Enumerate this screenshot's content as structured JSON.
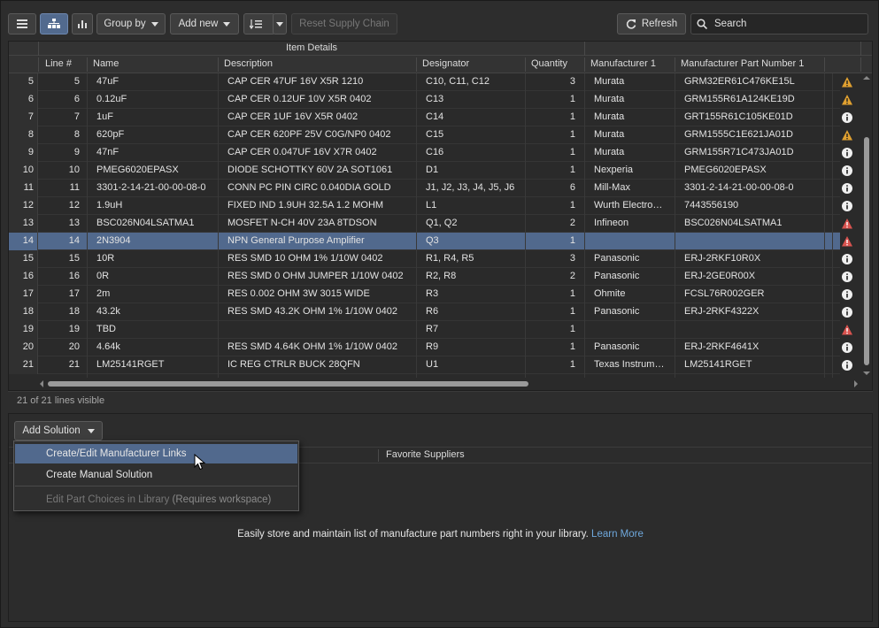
{
  "toolbar": {
    "group_by_label": "Group by",
    "add_new_label": "Add new",
    "reset_label": "Reset Supply Chain",
    "refresh_label": "Refresh",
    "search_placeholder": "Search"
  },
  "grid": {
    "group_header": "Item Details",
    "columns": [
      "Line #",
      "Name",
      "Description",
      "Designator",
      "Quantity",
      "Manufacturer 1",
      "Manufacturer Part Number 1"
    ],
    "rows": [
      {
        "idx": "5",
        "line": "5",
        "name": "47uF",
        "desc": "CAP CER 47UF 16V X5R 1210",
        "des": "C10, C11, C12",
        "qty": "3",
        "mfr": "Murata",
        "mpn": "GRM32ER61C476KE15L",
        "icon": "warning-icon"
      },
      {
        "idx": "6",
        "line": "6",
        "name": "0.12uF",
        "desc": "CAP CER 0.12UF 10V X5R 0402",
        "des": "C13",
        "qty": "1",
        "mfr": "Murata",
        "mpn": "GRM155R61A124KE19D",
        "icon": "warning-icon"
      },
      {
        "idx": "7",
        "line": "7",
        "name": "1uF",
        "desc": "CAP CER 1UF 16V X5R 0402",
        "des": "C14",
        "qty": "1",
        "mfr": "Murata",
        "mpn": "GRT155R61C105KE01D",
        "icon": "info-icon"
      },
      {
        "idx": "8",
        "line": "8",
        "name": "620pF",
        "desc": "CAP CER 620PF 25V C0G/NP0 0402",
        "des": "C15",
        "qty": "1",
        "mfr": "Murata",
        "mpn": "GRM1555C1E621JA01D",
        "icon": "warning-icon"
      },
      {
        "idx": "9",
        "line": "9",
        "name": "47nF",
        "desc": "CAP CER 0.047UF 16V X7R 0402",
        "des": "C16",
        "qty": "1",
        "mfr": "Murata",
        "mpn": "GRM155R71C473JA01D",
        "icon": "info-icon"
      },
      {
        "idx": "10",
        "line": "10",
        "name": "PMEG6020EPASX",
        "desc": "DIODE SCHOTTKY 60V 2A SOT1061",
        "des": "D1",
        "qty": "1",
        "mfr": "Nexperia",
        "mpn": "PMEG6020EPASX",
        "icon": "info-icon"
      },
      {
        "idx": "11",
        "line": "11",
        "name": "3301-2-14-21-00-00-08-0",
        "desc": "CONN PC PIN CIRC 0.040DIA GOLD",
        "des": "J1, J2, J3, J4, J5, J6",
        "qty": "6",
        "mfr": "Mill-Max",
        "mpn": "3301-2-14-21-00-00-08-0",
        "icon": "info-icon"
      },
      {
        "idx": "12",
        "line": "12",
        "name": "1.9uH",
        "desc": "FIXED IND 1.9UH 32.5A 1.2 MOHM",
        "des": "L1",
        "qty": "1",
        "mfr": "Wurth Electro…",
        "mpn": "7443556190",
        "icon": "info-icon"
      },
      {
        "idx": "13",
        "line": "13",
        "name": "BSC026N04LSATMA1",
        "desc": "MOSFET N-CH 40V 23A 8TDSON",
        "des": "Q1, Q2",
        "qty": "2",
        "mfr": "Infineon",
        "mpn": "BSC026N04LSATMA1",
        "icon": "error-icon"
      },
      {
        "idx": "14",
        "line": "14",
        "name": "2N3904",
        "desc": "NPN General Purpose Amplifier",
        "des": "Q3",
        "qty": "1",
        "mfr": "",
        "mpn": "",
        "icon": "error-icon",
        "selected": true
      },
      {
        "idx": "15",
        "line": "15",
        "name": "10R",
        "desc": "RES SMD 10 OHM 1% 1/10W 0402",
        "des": "R1, R4, R5",
        "qty": "3",
        "mfr": "Panasonic",
        "mpn": "ERJ-2RKF10R0X",
        "icon": "info-icon"
      },
      {
        "idx": "16",
        "line": "16",
        "name": "0R",
        "desc": "RES SMD 0 OHM JUMPER 1/10W 0402",
        "des": "R2, R8",
        "qty": "2",
        "mfr": "Panasonic",
        "mpn": "ERJ-2GE0R00X",
        "icon": "info-icon"
      },
      {
        "idx": "17",
        "line": "17",
        "name": "2m",
        "desc": "RES 0.002 OHM 3W 3015 WIDE",
        "des": "R3",
        "qty": "1",
        "mfr": "Ohmite",
        "mpn": "FCSL76R002GER",
        "icon": "info-icon"
      },
      {
        "idx": "18",
        "line": "18",
        "name": "43.2k",
        "desc": "RES SMD 43.2K OHM 1% 1/10W 0402",
        "des": "R6",
        "qty": "1",
        "mfr": "Panasonic",
        "mpn": "ERJ-2RKF4322X",
        "icon": "info-icon"
      },
      {
        "idx": "19",
        "line": "19",
        "name": "TBD",
        "desc": "",
        "des": "R7",
        "qty": "1",
        "mfr": "",
        "mpn": "",
        "icon": "error-icon"
      },
      {
        "idx": "20",
        "line": "20",
        "name": "4.64k",
        "desc": "RES SMD 4.64K OHM 1% 1/10W 0402",
        "des": "R9",
        "qty": "1",
        "mfr": "Panasonic",
        "mpn": "ERJ-2RKF4641X",
        "icon": "info-icon"
      },
      {
        "idx": "21",
        "line": "21",
        "name": "LM25141RGET",
        "desc": "IC REG CTRLR BUCK 28QFN",
        "des": "U1",
        "qty": "1",
        "mfr": "Texas Instrum…",
        "mpn": "LM25141RGET",
        "icon": "info-icon"
      }
    ]
  },
  "status": {
    "text": "21 of 21 lines visible"
  },
  "solution": {
    "add_label": "Add Solution",
    "header_col": "Favorite Suppliers",
    "hint_text": "Easily store and maintain list of manufacture part numbers right in your library.",
    "hint_link": "Learn More"
  },
  "menu": {
    "item1": "Create/Edit Manufacturer Links",
    "item2": "Create Manual Solution",
    "item3": "Edit Part Choices in Library",
    "item3_note": "(Requires workspace)"
  },
  "colors": {
    "selection": "#51698d",
    "warning": "#e0a030",
    "error": "#d9534f",
    "link": "#6fa8dc"
  }
}
